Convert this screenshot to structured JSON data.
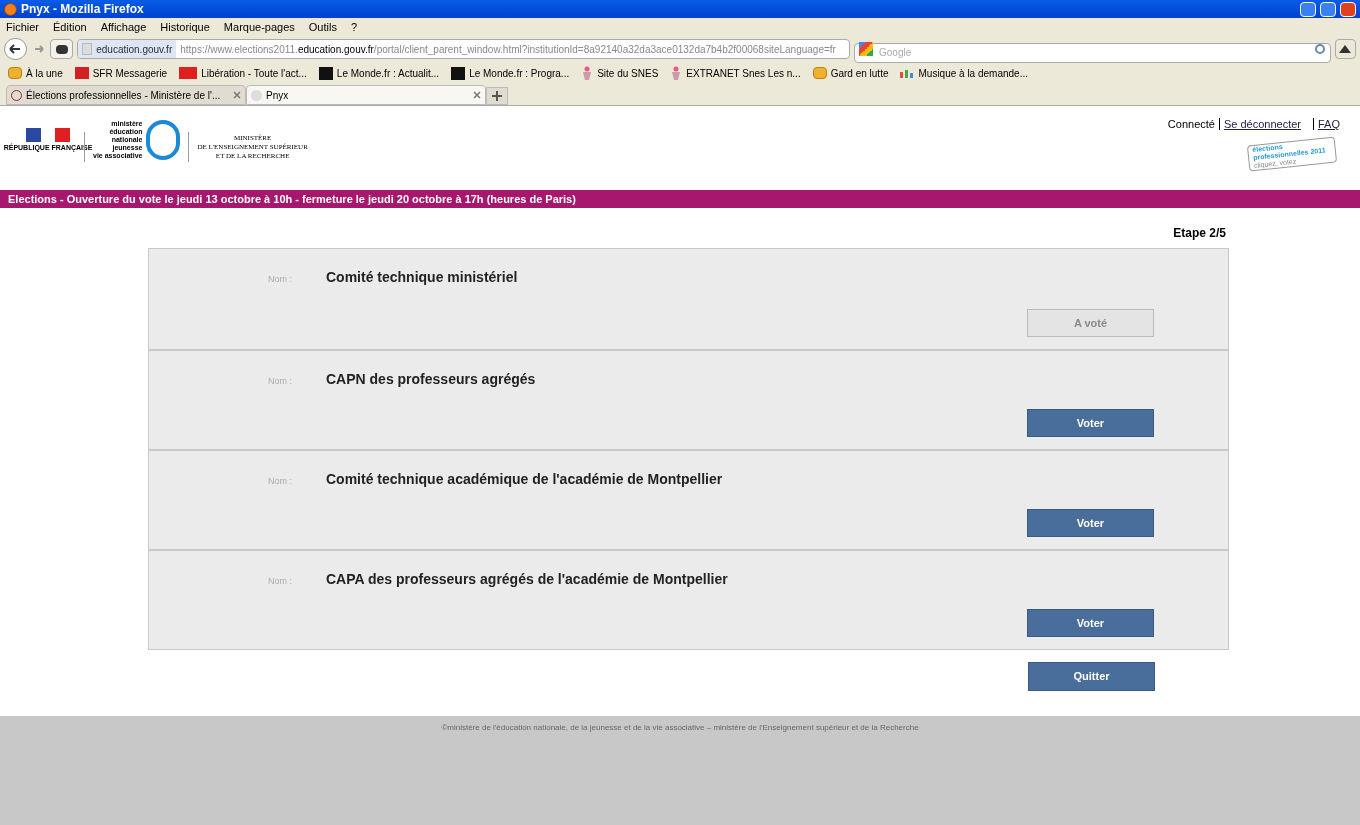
{
  "window": {
    "title": "Pnyx - Mozilla Firefox"
  },
  "menu": [
    "Fichier",
    "Édition",
    "Affichage",
    "Historique",
    "Marque-pages",
    "Outils",
    "?"
  ],
  "address": {
    "site": "education.gouv.fr",
    "url_prefix": "https://www.elections2011.",
    "url_domain": "education.gouv.fr",
    "url_rest": "/portal/client_parent_window.html?institutionId=8a92140a32da3ace0132da7b4b2f00068siteLanguage=fr"
  },
  "search": {
    "placeholder": "Google"
  },
  "bookmarks": [
    {
      "label": "À la une",
      "kind": "rss"
    },
    {
      "label": "SFR Messagerie",
      "kind": "sfr"
    },
    {
      "label": "Libération - Toute l'act...",
      "kind": "liberation"
    },
    {
      "label": "Le Monde.fr : Actualit...",
      "kind": "monde"
    },
    {
      "label": "Le Monde.fr : Progra...",
      "kind": "monde"
    },
    {
      "label": "Site du SNES",
      "kind": "snes"
    },
    {
      "label": "EXTRANET Snes Les n...",
      "kind": "snes"
    },
    {
      "label": "Gard en lutte",
      "kind": "rss"
    },
    {
      "label": "Musique à la demande...",
      "kind": "music"
    }
  ],
  "tabs": [
    {
      "label": "Élections professionnelles - Ministère de l'...",
      "selected": false
    },
    {
      "label": "Pnyx",
      "selected": true
    }
  ],
  "header": {
    "rf": "RÉPUBLIQUE FRANÇAISE",
    "ministry_lines": [
      "ministère",
      "éducation",
      "nationale",
      "jeunesse",
      "vie associative"
    ],
    "ministry2": [
      "MINISTÈRE",
      "DE L'ENSEIGNEMENT SUPÉRIEUR",
      "ET DE LA RECHERCHE"
    ],
    "connected": "Connecté",
    "logout": "Se déconnecter",
    "faq": "FAQ",
    "badge": [
      "élections",
      "professionnelles 2011",
      "cliquez, votez"
    ]
  },
  "banner": "Elections - Ouverture du vote le jeudi 13 octobre à 10h - fermeture le jeudi 20 octobre à 17h (heures de Paris)",
  "step": "Etape 2/5",
  "ballots": [
    {
      "label": "Nom :",
      "name": "Comité technique ministériel",
      "button": "A voté",
      "disabled": true
    },
    {
      "label": "Nom :",
      "name": "CAPN des professeurs agrégés",
      "button": "Voter",
      "disabled": false
    },
    {
      "label": "Nom :",
      "name": "Comité technique académique de l'académie de Montpellier",
      "button": "Voter",
      "disabled": false
    },
    {
      "label": "Nom :",
      "name": "CAPA des professeurs agrégés de l'académie de Montpellier",
      "button": "Voter",
      "disabled": false
    }
  ],
  "quit": "Quitter",
  "footer": "©ministère de l'éducation nationale, de la jeunesse et de la vie associative – ministère de l'Enseignement supérieur et de la Recherche"
}
